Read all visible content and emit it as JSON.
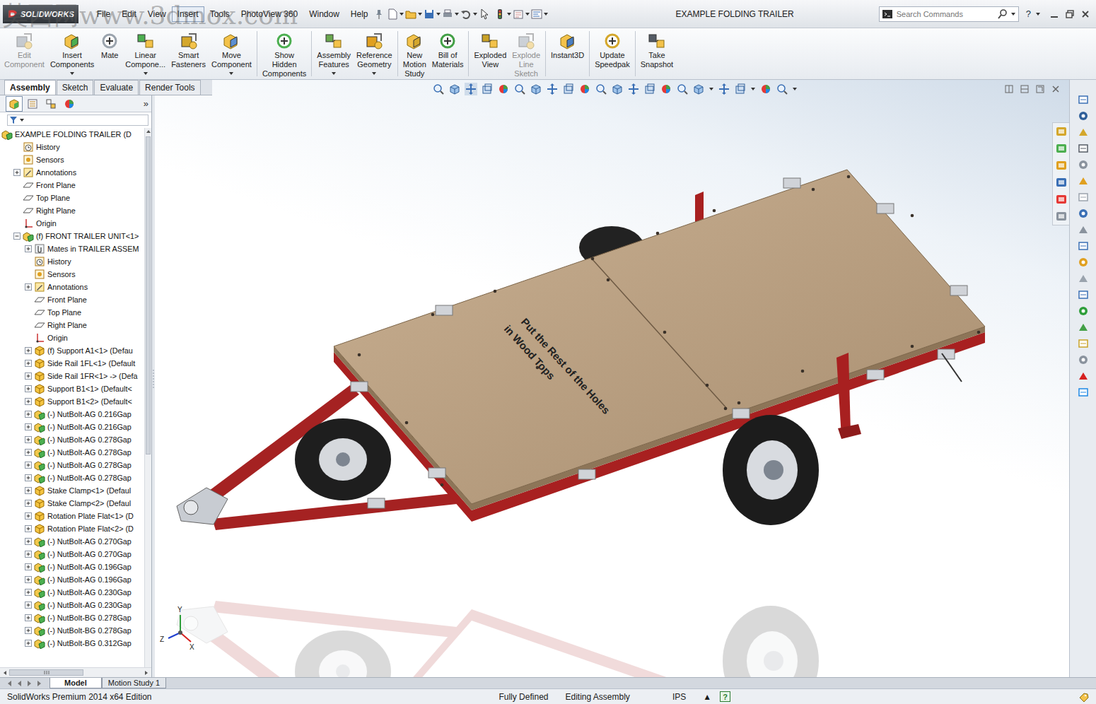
{
  "watermark": "莫西网www.3dmox.com",
  "app": {
    "logo": "SOLIDWORKS"
  },
  "menu": [
    {
      "label": "File",
      "selected": false
    },
    {
      "label": "Edit",
      "selected": false
    },
    {
      "label": "View",
      "selected": false
    },
    {
      "label": "Insert",
      "selected": true
    },
    {
      "label": "Tools",
      "selected": false
    },
    {
      "label": "PhotoView 360",
      "selected": false
    },
    {
      "label": "Window",
      "selected": false
    },
    {
      "label": "Help",
      "selected": false
    }
  ],
  "window": {
    "title": "EXAMPLE FOLDING TRAILER"
  },
  "search": {
    "placeholder": "Search Commands"
  },
  "help": "?",
  "ribbon": [
    {
      "lines": [
        "Edit",
        "Component"
      ],
      "disabled": true,
      "dropdown": false
    },
    {
      "lines": [
        "Insert",
        "Components"
      ],
      "disabled": false,
      "dropdown": true
    },
    {
      "lines": [
        "Mate"
      ],
      "disabled": false,
      "dropdown": false
    },
    {
      "lines": [
        "Linear",
        "Compone..."
      ],
      "disabled": false,
      "dropdown": true
    },
    {
      "lines": [
        "Smart",
        "Fasteners"
      ],
      "disabled": false,
      "dropdown": false
    },
    {
      "lines": [
        "Move",
        "Component"
      ],
      "disabled": false,
      "dropdown": true
    },
    {
      "lines": [
        "Show",
        "Hidden",
        "Components"
      ],
      "disabled": false,
      "dropdown": false
    },
    {
      "lines": [
        "Assembly",
        "Features"
      ],
      "disabled": false,
      "dropdown": true
    },
    {
      "lines": [
        "Reference",
        "Geometry"
      ],
      "disabled": false,
      "dropdown": true
    },
    {
      "lines": [
        "New",
        "Motion",
        "Study"
      ],
      "disabled": false,
      "dropdown": false
    },
    {
      "lines": [
        "Bill of",
        "Materials"
      ],
      "disabled": false,
      "dropdown": false
    },
    {
      "lines": [
        "Exploded",
        "View"
      ],
      "disabled": false,
      "dropdown": false
    },
    {
      "lines": [
        "Explode",
        "Line",
        "Sketch"
      ],
      "disabled": true,
      "dropdown": false
    },
    {
      "lines": [
        "Instant3D"
      ],
      "disabled": false,
      "dropdown": false
    },
    {
      "lines": [
        "Update",
        "Speedpak"
      ],
      "disabled": false,
      "dropdown": false
    },
    {
      "lines": [
        "Take",
        "Snapshot"
      ],
      "disabled": false,
      "dropdown": false
    }
  ],
  "tabs": [
    {
      "label": "Assembly",
      "selected": true
    },
    {
      "label": "Sketch",
      "selected": false
    },
    {
      "label": "Evaluate",
      "selected": false
    },
    {
      "label": "Render Tools",
      "selected": false
    }
  ],
  "left_panel": {
    "tabs": [
      {
        "selected": true
      },
      {
        "selected": false
      },
      {
        "selected": false
      },
      {
        "selected": false
      }
    ],
    "more": "»"
  },
  "tree": {
    "items": [
      {
        "text": "EXAMPLE FOLDING TRAILER (D",
        "depth": 0,
        "kind": "assembly",
        "toggle": "none"
      },
      {
        "text": "History",
        "depth": 1,
        "kind": "history",
        "toggle": "none"
      },
      {
        "text": "Sensors",
        "depth": 1,
        "kind": "sensor",
        "toggle": "none"
      },
      {
        "text": "Annotations",
        "depth": 1,
        "kind": "annotation",
        "toggle": "collapsed"
      },
      {
        "text": "Front Plane",
        "depth": 1,
        "kind": "plane",
        "toggle": "none"
      },
      {
        "text": "Top Plane",
        "depth": 1,
        "kind": "plane",
        "toggle": "none"
      },
      {
        "text": "Right Plane",
        "depth": 1,
        "kind": "plane",
        "toggle": "none"
      },
      {
        "text": "Origin",
        "depth": 1,
        "kind": "origin",
        "toggle": "none"
      },
      {
        "text": "(f) FRONT TRAILER UNIT<1>",
        "depth": 1,
        "kind": "assembly",
        "toggle": "expanded"
      },
      {
        "text": "Mates in TRAILER ASSEM",
        "depth": 2,
        "kind": "mates",
        "toggle": "collapsed"
      },
      {
        "text": "History",
        "depth": 2,
        "kind": "history",
        "toggle": "none"
      },
      {
        "text": "Sensors",
        "depth": 2,
        "kind": "sensor",
        "toggle": "none"
      },
      {
        "text": "Annotations",
        "depth": 2,
        "kind": "annotation",
        "toggle": "collapsed"
      },
      {
        "text": "Front Plane",
        "depth": 2,
        "kind": "plane",
        "toggle": "none"
      },
      {
        "text": "Top Plane",
        "depth": 2,
        "kind": "plane",
        "toggle": "none"
      },
      {
        "text": "Right Plane",
        "depth": 2,
        "kind": "plane",
        "toggle": "none"
      },
      {
        "text": "Origin",
        "depth": 2,
        "kind": "origin",
        "toggle": "none"
      },
      {
        "text": "(f) Support A1<1> (Defau",
        "depth": 2,
        "kind": "part",
        "toggle": "collapsed"
      },
      {
        "text": "Side Rail 1FL<1> (Default",
        "depth": 2,
        "kind": "part",
        "toggle": "collapsed"
      },
      {
        "text": "Side Rail 1FR<1> -> (Defa",
        "depth": 2,
        "kind": "part",
        "toggle": "collapsed"
      },
      {
        "text": "Support B1<1> (Default<",
        "depth": 2,
        "kind": "part",
        "toggle": "collapsed"
      },
      {
        "text": "Support B1<2> (Default<",
        "depth": 2,
        "kind": "part",
        "toggle": "collapsed"
      },
      {
        "text": "(-) NutBolt-AG 0.216Gap",
        "depth": 2,
        "kind": "assembly",
        "toggle": "collapsed"
      },
      {
        "text": "(-) NutBolt-AG 0.216Gap",
        "depth": 2,
        "kind": "assembly",
        "toggle": "collapsed"
      },
      {
        "text": "(-) NutBolt-AG 0.278Gap",
        "depth": 2,
        "kind": "assembly",
        "toggle": "collapsed"
      },
      {
        "text": "(-) NutBolt-AG 0.278Gap",
        "depth": 2,
        "kind": "assembly",
        "toggle": "collapsed"
      },
      {
        "text": "(-) NutBolt-AG 0.278Gap",
        "depth": 2,
        "kind": "assembly",
        "toggle": "collapsed"
      },
      {
        "text": "(-) NutBolt-AG 0.278Gap",
        "depth": 2,
        "kind": "assembly",
        "toggle": "collapsed"
      },
      {
        "text": "Stake Clamp<1> (Defaul",
        "depth": 2,
        "kind": "part",
        "toggle": "collapsed"
      },
      {
        "text": "Stake Clamp<2> (Defaul",
        "depth": 2,
        "kind": "part",
        "toggle": "collapsed"
      },
      {
        "text": "Rotation Plate Flat<1> (D",
        "depth": 2,
        "kind": "part",
        "toggle": "collapsed"
      },
      {
        "text": "Rotation Plate Flat<2> (D",
        "depth": 2,
        "kind": "part",
        "toggle": "collapsed"
      },
      {
        "text": "(-) NutBolt-AG 0.270Gap",
        "depth": 2,
        "kind": "assembly",
        "toggle": "collapsed"
      },
      {
        "text": "(-) NutBolt-AG 0.270Gap",
        "depth": 2,
        "kind": "assembly",
        "toggle": "collapsed"
      },
      {
        "text": "(-) NutBolt-AG 0.196Gap",
        "depth": 2,
        "kind": "assembly",
        "toggle": "collapsed"
      },
      {
        "text": "(-) NutBolt-AG 0.196Gap",
        "depth": 2,
        "kind": "assembly",
        "toggle": "collapsed"
      },
      {
        "text": "(-) NutBolt-AG 0.230Gap",
        "depth": 2,
        "kind": "assembly",
        "toggle": "collapsed"
      },
      {
        "text": "(-) NutBolt-AG 0.230Gap",
        "depth": 2,
        "kind": "assembly",
        "toggle": "collapsed"
      },
      {
        "text": "(-) NutBolt-BG 0.278Gap",
        "depth": 2,
        "kind": "assembly",
        "toggle": "collapsed"
      },
      {
        "text": "(-) NutBolt-BG 0.278Gap",
        "depth": 2,
        "kind": "assembly",
        "toggle": "collapsed"
      },
      {
        "text": "(-) NutBolt-BG 0.312Gap",
        "depth": 2,
        "kind": "assembly",
        "toggle": "collapsed"
      }
    ]
  },
  "model": {
    "label": [
      "Put the Rest of the Holes",
      "in Wood Tops"
    ]
  },
  "triad": {
    "y": "Y",
    "x": "X",
    "z": "Z"
  },
  "bottom_tabs": [
    {
      "label": "Model",
      "selected": true
    },
    {
      "label": "Motion Study 1",
      "selected": false
    }
  ],
  "status_bar": {
    "edition": "SolidWorks Premium 2014 x64 Edition",
    "state": "Fully Defined",
    "mode": "Editing Assembly",
    "units": "IPS",
    "arrow": "▲",
    "help": "?"
  }
}
